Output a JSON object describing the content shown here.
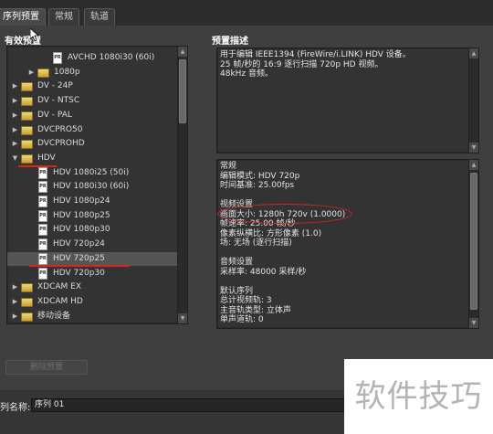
{
  "tabs": [
    {
      "label": "序列预置",
      "active": true
    },
    {
      "label": "常规",
      "active": false
    },
    {
      "label": "轨道",
      "active": false
    }
  ],
  "presets_group": {
    "title": "有效预置"
  },
  "tree": [
    {
      "label": "AVCHD 1080i30 (60i)",
      "kind": "file"
    },
    {
      "label": "1080p",
      "kind": "folder",
      "expanded": false
    },
    {
      "label": "DV - 24P",
      "kind": "folder",
      "expanded": false
    },
    {
      "label": "DV - NTSC",
      "kind": "folder",
      "expanded": false
    },
    {
      "label": "DV - PAL",
      "kind": "folder",
      "expanded": false
    },
    {
      "label": "DVCPRO50",
      "kind": "folder",
      "expanded": false
    },
    {
      "label": "DVCPROHD",
      "kind": "folder",
      "expanded": false
    },
    {
      "label": "HDV",
      "kind": "folder",
      "expanded": true
    },
    {
      "label": "HDV 1080i25 (50i)",
      "kind": "file"
    },
    {
      "label": "HDV 1080i30 (60i)",
      "kind": "file"
    },
    {
      "label": "HDV 1080p24",
      "kind": "file"
    },
    {
      "label": "HDV 1080p25",
      "kind": "file"
    },
    {
      "label": "HDV 1080p30",
      "kind": "file"
    },
    {
      "label": "HDV 720p24",
      "kind": "file"
    },
    {
      "label": "HDV 720p25",
      "kind": "file",
      "selected": true
    },
    {
      "label": "HDV 720p30",
      "kind": "file"
    },
    {
      "label": "XDCAM EX",
      "kind": "folder",
      "expanded": false
    },
    {
      "label": "XDCAM HD",
      "kind": "folder",
      "expanded": false
    },
    {
      "label": "移动设备",
      "kind": "folder",
      "expanded": false
    }
  ],
  "description_group": {
    "title": "预置描述"
  },
  "description_lines": [
    "用于编辑 IEEE1394 (FireWire/i.LINK) HDV 设备。",
    "25 帧/秒的 16:9 逐行扫描 720p HD 视频。",
    "48kHz 音频。"
  ],
  "info_lines": [
    "常规",
    " 编辑模式: HDV 720p",
    " 时间基准: 25.00fps",
    "",
    "视频设置",
    " 画面大小: 1280h 720v (1.0000)",
    " 帧速率: 25.00 帧/秒",
    " 像素纵横比: 方形像素 (1.0)",
    " 场: 无场 (逐行扫描)",
    "",
    "音频设置",
    " 采样率: 48000 采样/秒",
    "",
    "默认序列",
    " 总计视频轨: 3",
    " 主音轨类型: 立体声",
    " 单声道轨: 0"
  ],
  "buttons": {
    "delete_preset": "删除预置"
  },
  "sequence_name": {
    "label": "列名称:",
    "value": "序列 01"
  },
  "watermark": "软件技巧",
  "colors": {
    "annotation_red": "#d6261e",
    "selected_row": "#555555"
  }
}
